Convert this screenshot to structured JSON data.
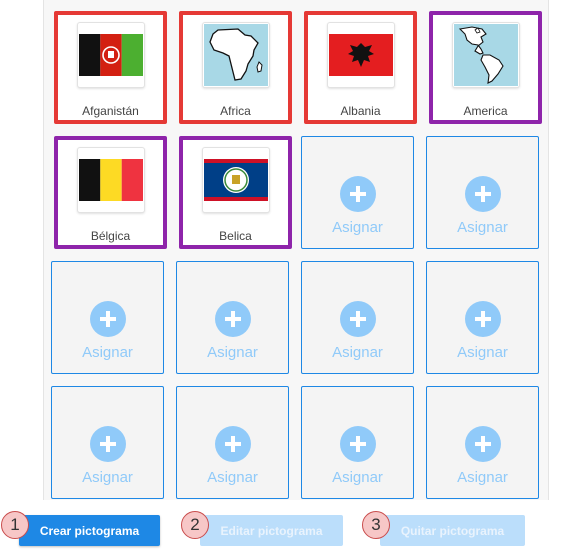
{
  "grid": {
    "cells": [
      {
        "state": "assigned",
        "label": "Afganistán",
        "icon": "afghanistan-flag-icon",
        "highlight": "red"
      },
      {
        "state": "assigned",
        "label": "Africa",
        "icon": "africa-map-icon",
        "highlight": "red"
      },
      {
        "state": "assigned",
        "label": "Albania",
        "icon": "albania-flag-icon",
        "highlight": "red"
      },
      {
        "state": "assigned",
        "label": "America",
        "icon": "america-map-icon",
        "highlight": "purple"
      },
      {
        "state": "assigned",
        "label": "Bélgica",
        "icon": "belgium-flag-icon",
        "highlight": "purple"
      },
      {
        "state": "assigned",
        "label": "Belica",
        "icon": "belize-flag-icon",
        "highlight": "purple"
      },
      {
        "state": "empty",
        "label": "Asignar"
      },
      {
        "state": "empty",
        "label": "Asignar"
      },
      {
        "state": "empty",
        "label": "Asignar"
      },
      {
        "state": "empty",
        "label": "Asignar"
      },
      {
        "state": "empty",
        "label": "Asignar"
      },
      {
        "state": "empty",
        "label": "Asignar"
      },
      {
        "state": "empty",
        "label": "Asignar"
      },
      {
        "state": "empty",
        "label": "Asignar"
      },
      {
        "state": "empty",
        "label": "Asignar"
      },
      {
        "state": "empty",
        "label": "Asignar"
      }
    ]
  },
  "actions": {
    "create_label": "Crear pictograma",
    "edit_label": "Editar pictograma",
    "remove_label": "Quitar pictograma",
    "edit_enabled": false,
    "remove_enabled": false
  },
  "markers": [
    "1",
    "2",
    "3"
  ],
  "colors": {
    "highlight_red": "#e53935",
    "highlight_purple": "#8e24aa",
    "primary": "#1e88e5",
    "primary_disabled": "#bbdefb",
    "assign_accent": "#90caf9"
  }
}
